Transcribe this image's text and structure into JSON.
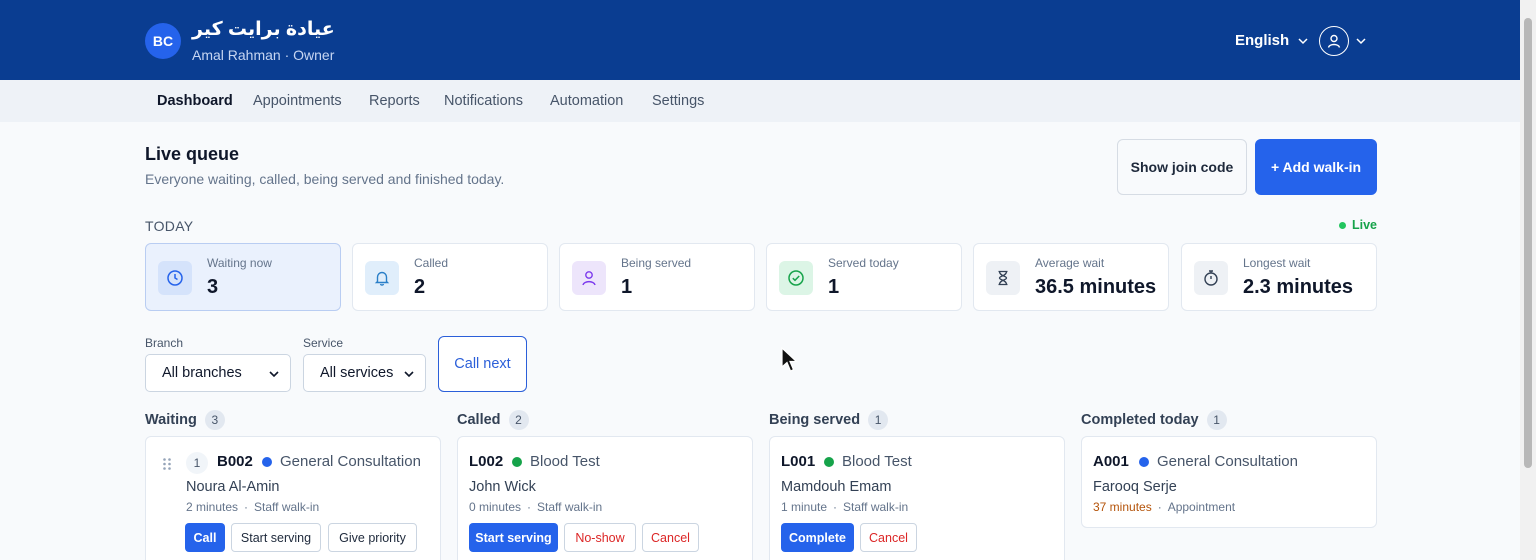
{
  "header": {
    "avatar_initials": "BC",
    "clinic_name": "عيادة برايت كير",
    "user_line": "Amal Rahman · Owner",
    "language": "English",
    "brand_color": "#0a3d91"
  },
  "nav": {
    "items": [
      {
        "label": "Dashboard",
        "active": true
      },
      {
        "label": "Appointments"
      },
      {
        "label": "Reports"
      },
      {
        "label": "Notifications"
      },
      {
        "label": "Automation"
      },
      {
        "label": "Settings"
      }
    ]
  },
  "page": {
    "title": "Live queue",
    "subtitle": "Everyone waiting, called, being served and finished today.",
    "join_code_label": "Show join code",
    "add_walkin_label": "+ Add walk-in",
    "today_label": "TODAY",
    "live_label": "Live"
  },
  "stats": [
    {
      "label": "Waiting now",
      "value": "3",
      "icon": "clock-icon"
    },
    {
      "label": "Called",
      "value": "2",
      "icon": "bell-icon"
    },
    {
      "label": "Being served",
      "value": "1",
      "icon": "user-icon"
    },
    {
      "label": "Served today",
      "value": "1",
      "icon": "check-circle-icon"
    },
    {
      "label": "Average wait",
      "value": "36.5 minutes",
      "icon": "hourglass-icon"
    },
    {
      "label": "Longest wait",
      "value": "2.3 minutes",
      "icon": "stopwatch-icon"
    }
  ],
  "filters": {
    "branch_label": "Branch",
    "branch_value": "All branches",
    "service_label": "Service",
    "service_value": "All services",
    "call_next_label": "Call next"
  },
  "columns": [
    {
      "title": "Waiting",
      "count": "3",
      "card": {
        "position": "1",
        "ticket": "B002",
        "service": "General Consultation",
        "dot_color": "#2563eb",
        "name": "Noura Al-Amin",
        "wait": "2 minutes",
        "source": "Staff walk-in",
        "actions": [
          "Call",
          "Start serving",
          "Give priority"
        ]
      }
    },
    {
      "title": "Called",
      "count": "2",
      "card": {
        "ticket": "L002",
        "service": "Blood Test",
        "dot_color": "#16a34a",
        "name": "John Wick",
        "wait": "0 minutes",
        "source": "Staff walk-in",
        "actions": [
          "Start serving",
          "No-show",
          "Cancel"
        ]
      }
    },
    {
      "title": "Being served",
      "count": "1",
      "card": {
        "ticket": "L001",
        "service": "Blood Test",
        "dot_color": "#16a34a",
        "name": "Mamdouh Emam",
        "wait": "1 minute",
        "source": "Staff walk-in",
        "actions": [
          "Complete",
          "Cancel"
        ]
      }
    },
    {
      "title": "Completed today",
      "count": "1",
      "card": {
        "ticket": "A001",
        "service": "General Consultation",
        "dot_color": "#2563eb",
        "name": "Farooq Serje",
        "wait": "37 minutes",
        "source": "Appointment"
      }
    }
  ]
}
